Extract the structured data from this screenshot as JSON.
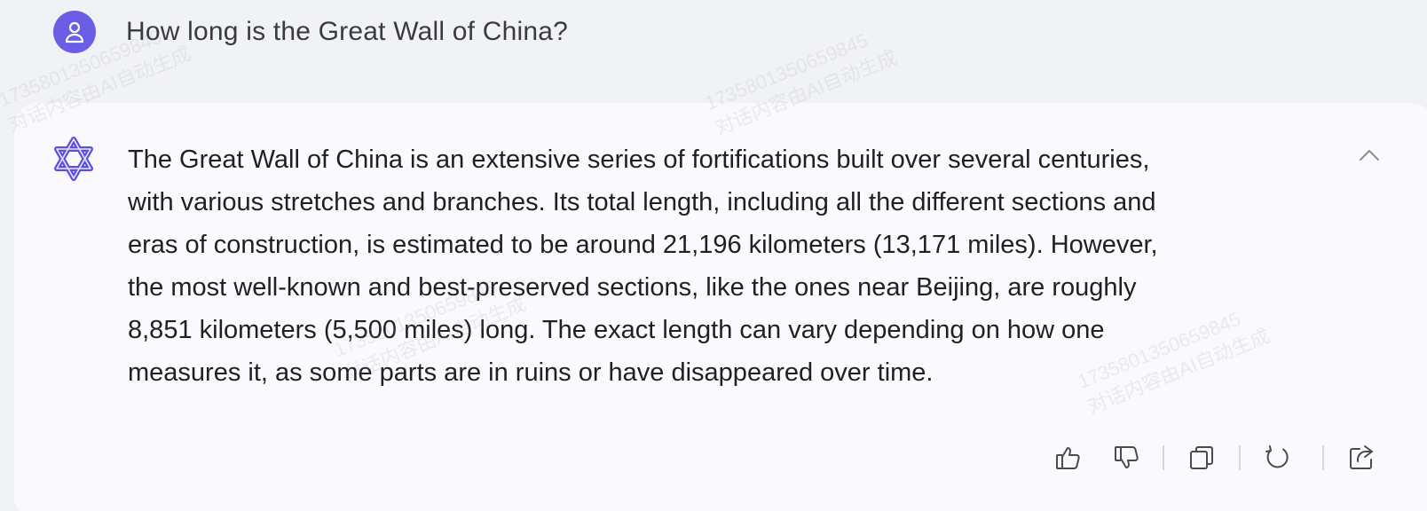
{
  "user": {
    "avatar_icon": "user-icon",
    "question": "How long is the Great Wall of China?"
  },
  "assistant": {
    "logo_icon": "qwen-logo-icon",
    "answer_lines": [
      "The Great Wall of China is an extensive series of fortifications built over several centuries,",
      "with various stretches and branches. Its total length, including all the different sections and",
      "eras of construction, is estimated to be around 21,196 kilometers (13,171 miles). However,",
      "the most well-known and best-preserved sections, like the ones near Beijing, are roughly",
      "8,851 kilometers (5,500 miles) long. The exact length can vary depending on how one",
      "measures it, as some parts are in ruins or have disappeared over time."
    ]
  },
  "watermark": {
    "line1": "1735801350659845",
    "line2": "对话内容由AI自动生成"
  },
  "actions": {
    "icons": [
      "thumbs-up-icon",
      "thumbs-down-icon",
      "copy-icon",
      "regenerate-icon",
      "share-icon"
    ]
  },
  "colors": {
    "avatar": "#6a5de6",
    "logo": "#5b4fe0",
    "background": "#f1f2f6",
    "card": "#fafafc",
    "text": "#1f1f25",
    "icon": "#4a4a55"
  }
}
